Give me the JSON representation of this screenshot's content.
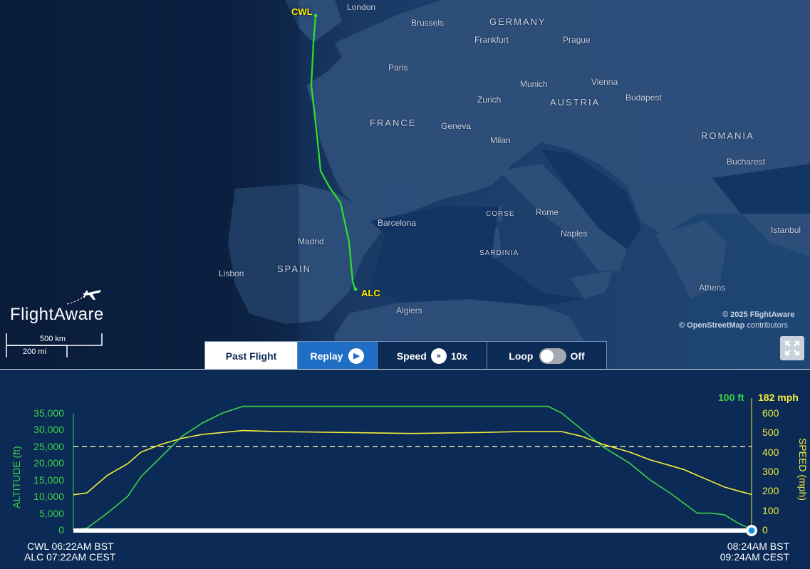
{
  "map": {
    "cities": [
      {
        "name": "London"
      },
      {
        "name": "Brussels"
      },
      {
        "name": "Frankfurt"
      },
      {
        "name": "Prague"
      },
      {
        "name": "Paris"
      },
      {
        "name": "Munich"
      },
      {
        "name": "Vienna"
      },
      {
        "name": "Budapest"
      },
      {
        "name": "Zurich"
      },
      {
        "name": "Geneva"
      },
      {
        "name": "Milan"
      },
      {
        "name": "Bucharest"
      },
      {
        "name": "Barcelona"
      },
      {
        "name": "Rome"
      },
      {
        "name": "Naples"
      },
      {
        "name": "Madrid"
      },
      {
        "name": "Lisbon"
      },
      {
        "name": "Istanbul"
      },
      {
        "name": "Athens"
      },
      {
        "name": "Algiers"
      }
    ],
    "countries": [
      {
        "name": "GERMANY"
      },
      {
        "name": "AUSTRIA"
      },
      {
        "name": "FRANCE"
      },
      {
        "name": "ROMANIA"
      },
      {
        "name": "SPAIN"
      },
      {
        "name": "CORSE"
      },
      {
        "name": "SARDINIA"
      }
    ],
    "origin_code": "CWL",
    "destination_code": "ALC",
    "attribution_line1": "© 2025 FlightAware",
    "attribution_osm": "© OpenStreetMap",
    "attribution_contributors": " contributors",
    "scale_km": "500 km",
    "scale_mi": "200 mi",
    "logo": "FlightAware",
    "route_color": "#2de02d"
  },
  "controls": {
    "past_flight": "Past Flight",
    "replay": "Replay",
    "speed": "Speed",
    "speed_value": "10x",
    "loop": "Loop",
    "loop_state": "Off"
  },
  "chart_data": {
    "type": "line",
    "altitude_axis_label": "ALTITUDE (ft)",
    "speed_axis_label": "SPEED (mph)",
    "altitude_ticks": [
      "35,000",
      "30,000",
      "25,000",
      "20,000",
      "15,000",
      "10,000",
      "5,000",
      "0"
    ],
    "speed_ticks": [
      "600",
      "500",
      "400",
      "300",
      "200",
      "100",
      "0"
    ],
    "ylim_altitude": [
      0,
      35000
    ],
    "ylim_speed": [
      0,
      600
    ],
    "current_altitude": "100 ft",
    "current_speed": "182 mph",
    "reference_line_altitude": 25000,
    "x": [
      0,
      0.02,
      0.05,
      0.08,
      0.1,
      0.13,
      0.16,
      0.19,
      0.22,
      0.25,
      0.3,
      0.4,
      0.5,
      0.6,
      0.66,
      0.7,
      0.72,
      0.75,
      0.78,
      0.82,
      0.85,
      0.88,
      0.9,
      0.92,
      0.94,
      0.96,
      0.98,
      1.0
    ],
    "series": [
      {
        "name": "altitude",
        "color": "#3bd24a",
        "values": [
          0,
          500,
          5000,
          10000,
          16000,
          22000,
          28000,
          32000,
          35000,
          37000,
          37000,
          37000,
          37000,
          37000,
          37000,
          37000,
          35000,
          30000,
          25000,
          20000,
          15000,
          11000,
          8000,
          5000,
          5000,
          4500,
          2000,
          100
        ]
      },
      {
        "name": "speed",
        "color": "#f2ee3c",
        "values": [
          180,
          190,
          280,
          340,
          400,
          440,
          470,
          490,
          500,
          510,
          505,
          500,
          495,
          500,
          505,
          505,
          505,
          480,
          440,
          400,
          360,
          330,
          310,
          280,
          250,
          220,
          200,
          182
        ]
      }
    ],
    "origin_time_line1": "CWL 06:22AM BST",
    "origin_time_line2": "ALC 07:22AM CEST",
    "dest_time_line1": "08:24AM BST",
    "dest_time_line2": "09:24AM CEST"
  }
}
